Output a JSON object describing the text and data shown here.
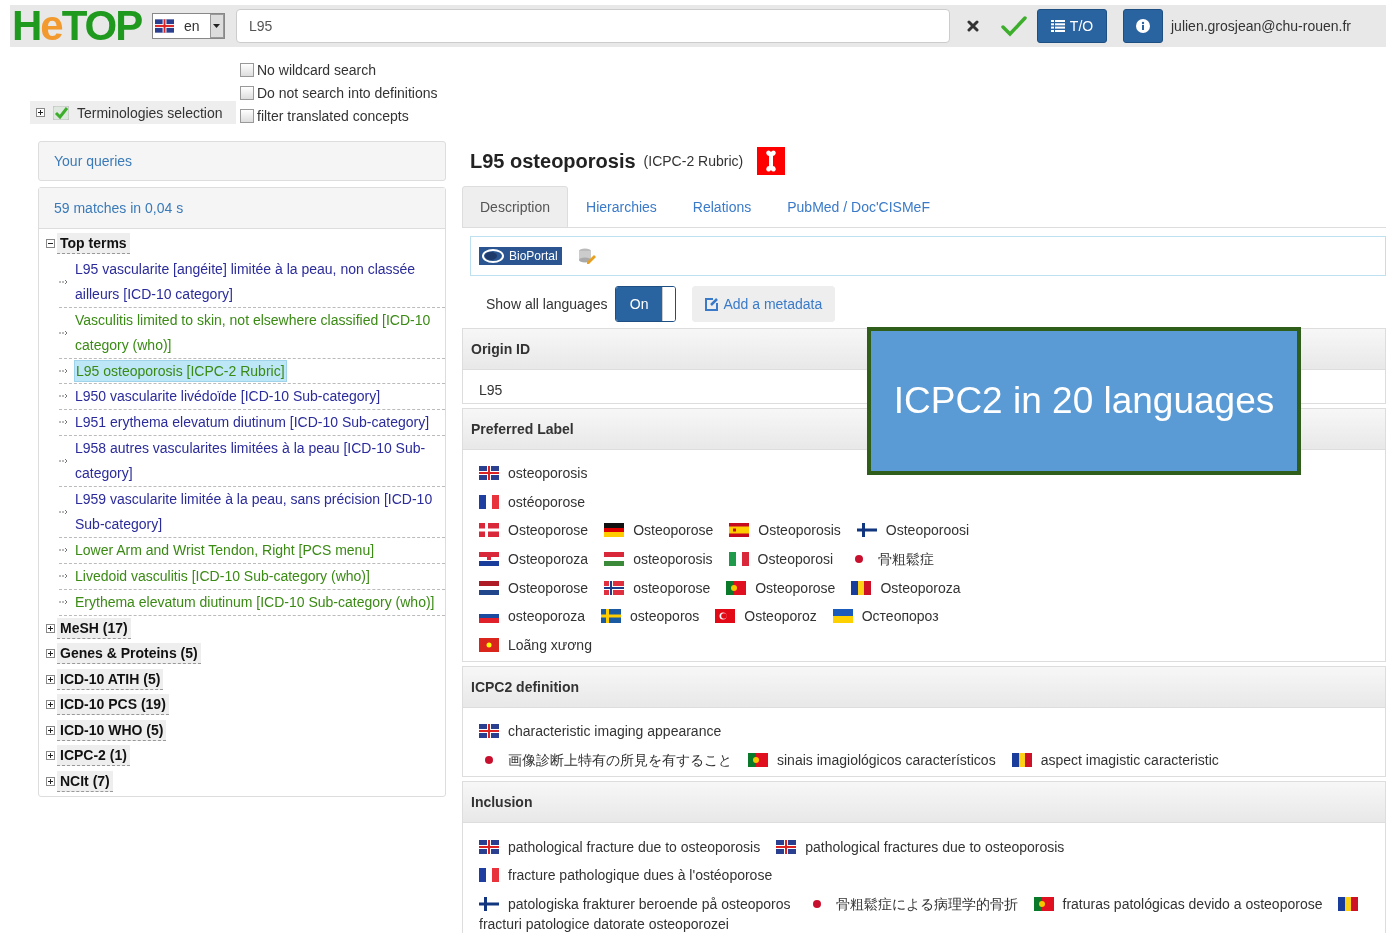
{
  "header": {
    "logo": [
      {
        "text": "H",
        "color": "#1f9a1f"
      },
      {
        "text": "e",
        "color": "#f29a2e"
      },
      {
        "text": "TOP",
        "color": "#1f9a1f"
      }
    ],
    "language": {
      "kind": "gb",
      "value": "en"
    },
    "search": {
      "value": "L95"
    },
    "to_button": "T/O",
    "user": "julien.grosjean@chu-rouen.fr"
  },
  "options": [
    {
      "label": "No wildcard search",
      "checked": false
    },
    {
      "label": "Do not search into definitions",
      "checked": false
    },
    {
      "label": "filter translated concepts",
      "checked": false
    }
  ],
  "terminologies_selection": {
    "label": "Terminologies selection",
    "expanded": false,
    "checked": true
  },
  "queries": {
    "title": "Your queries"
  },
  "results": {
    "summary": "59 matches in 0,04 s",
    "groups": [
      {
        "label": "Top terms",
        "expanded": true,
        "items": [
          {
            "text": "L95 vascularite [angéite] limitée à la peau, non classée ailleurs [ICD-10 category]",
            "color": "#2b2b9b",
            "selected": false
          },
          {
            "text": "Vasculitis limited to skin, not elsewhere classified [ICD-10 category (who)]",
            "color": "#3a8a14",
            "selected": false
          },
          {
            "text": "L95 osteoporosis [ICPC-2 Rubric]",
            "color": "#3a8a14",
            "selected": true
          },
          {
            "text": "L950 vascularite livédoïde [ICD-10 Sub-category]",
            "color": "#2b2b9b",
            "selected": false
          },
          {
            "text": "L951 erythema elevatum diutinum [ICD-10 Sub-category]",
            "color": "#2b2b9b",
            "selected": false
          },
          {
            "text": "L958 autres vascularites limitées à la peau [ICD-10 Sub-category]",
            "color": "#2b2b9b",
            "selected": false
          },
          {
            "text": "L959 vascularite limitée à la peau, sans précision [ICD-10 Sub-category]",
            "color": "#2b2b9b",
            "selected": false
          },
          {
            "text": "Lower Arm and Wrist Tendon, Right [PCS menu]",
            "color": "#3a8a14",
            "selected": false
          },
          {
            "text": "Livedoid vasculitis [ICD-10 Sub-category (who)]",
            "color": "#3a8a14",
            "selected": false
          },
          {
            "text": "Erythema elevatum diutinum [ICD-10 Sub-category (who)]",
            "color": "#3a8a14",
            "selected": false
          }
        ]
      },
      {
        "label": "MeSH (17)",
        "expanded": false
      },
      {
        "label": "Genes & Proteins (5)",
        "expanded": false
      },
      {
        "label": "ICD-10 ATIH (5)",
        "expanded": false
      },
      {
        "label": "ICD-10 PCS (19)",
        "expanded": false
      },
      {
        "label": "ICD-10 WHO (5)",
        "expanded": false
      },
      {
        "label": "ICPC-2 (1)",
        "expanded": false
      },
      {
        "label": "NCIt (7)",
        "expanded": false
      }
    ]
  },
  "concept": {
    "title": "L95 osteoporosis",
    "type": "(ICPC-2 Rubric)",
    "tabs": [
      {
        "label": "Description",
        "selected": true
      },
      {
        "label": "Hierarchies",
        "selected": false
      },
      {
        "label": "Relations",
        "selected": false
      },
      {
        "label": "PubMed / Doc'CISMeF",
        "selected": false
      }
    ],
    "bioportal": "BioPortal",
    "show_all_languages": {
      "label": "Show all languages",
      "on": true,
      "state_label": "On"
    },
    "add_metadata": "Add a metadata",
    "sections": [
      {
        "title": "Origin ID",
        "kind": "text",
        "value": "L95"
      },
      {
        "title": "Preferred Label",
        "kind": "terms",
        "lines": [
          [
            {
              "kind": "gb",
              "text": "osteoporosis"
            }
          ],
          [
            {
              "kind": "fr",
              "text": "ostéoporose"
            }
          ],
          [
            {
              "kind": "dk",
              "text": "Osteoporose"
            },
            {
              "kind": "de",
              "text": "Osteoporose"
            },
            {
              "kind": "es",
              "text": "Osteoporosis"
            },
            {
              "kind": "fi",
              "text": "Osteoporoosi"
            }
          ],
          [
            {
              "kind": "hr",
              "text": "Osteoporoza"
            },
            {
              "kind": "hu",
              "text": "osteoporosis"
            },
            {
              "kind": "it",
              "text": "Osteoporosi"
            },
            {
              "kind": "jp",
              "text": "骨粗鬆症"
            }
          ],
          [
            {
              "kind": "nl",
              "text": "Osteoporose"
            },
            {
              "kind": "no",
              "text": "osteoporose"
            },
            {
              "kind": "pt",
              "text": "Osteoporose"
            },
            {
              "kind": "ro",
              "text": "Osteoporoza"
            }
          ],
          [
            {
              "kind": "si",
              "text": "osteoporoza"
            },
            {
              "kind": "se",
              "text": "osteoporos"
            },
            {
              "kind": "tr",
              "text": "Osteoporoz"
            },
            {
              "kind": "ua",
              "text": "Остеопороз"
            }
          ],
          [
            {
              "kind": "vn",
              "text": "Loãng xương"
            }
          ]
        ]
      },
      {
        "title": "ICPC2 definition",
        "kind": "terms",
        "lines": [
          [
            {
              "kind": "gb",
              "text": "characteristic imaging appearance"
            }
          ],
          [
            {
              "kind": "jp",
              "text": "画像診断上特有の所見を有すること"
            },
            {
              "kind": "pt",
              "text": "sinais imagiológicos característicos"
            },
            {
              "kind": "ro",
              "text": "aspect imagistic caracteristic"
            }
          ]
        ]
      },
      {
        "title": "Inclusion",
        "kind": "terms",
        "lines": [
          [
            {
              "kind": "gb",
              "text": "pathological fracture due to osteoporosis"
            },
            {
              "kind": "gb",
              "text": "pathological fractures due to osteoporosis"
            }
          ],
          [
            {
              "kind": "fr",
              "text": "fracture pathologique dues à l'ostéoporose"
            }
          ],
          [
            {
              "kind": "fi",
              "text": "patologiska frakturer beroende på osteoporos"
            },
            {
              "kind": "jp",
              "text": "骨粗鬆症による病理学的骨折"
            },
            {
              "kind": "pt",
              "text": "fraturas patológicas devido a osteoporose"
            },
            {
              "kind": "ro",
              "text": "fracturi patologice datorate osteoporozei"
            }
          ]
        ]
      }
    ]
  },
  "callout": {
    "text": "ICPC2 in 20 languages"
  }
}
